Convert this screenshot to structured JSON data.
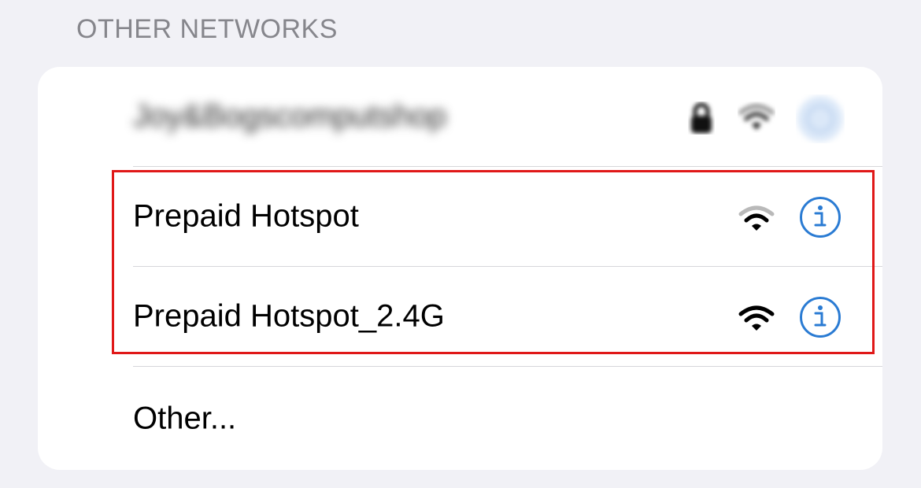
{
  "section_header": "OTHER NETWORKS",
  "networks": [
    {
      "name": "Joy&Bogscomputshop",
      "secured": true,
      "blurred": true,
      "signal_bars": 3
    },
    {
      "name": "Prepaid Hotspot",
      "secured": false,
      "blurred": false,
      "signal_bars": 2
    },
    {
      "name": "Prepaid Hotspot_2.4G",
      "secured": false,
      "blurred": false,
      "signal_bars": 3
    }
  ],
  "other_label": "Other...",
  "icons": {
    "wifi": "wifi-icon",
    "info": "info-icon",
    "lock": "lock-icon"
  },
  "colors": {
    "accent": "#2a7bd3",
    "highlight": "#e01818",
    "header_text": "#86868c"
  }
}
